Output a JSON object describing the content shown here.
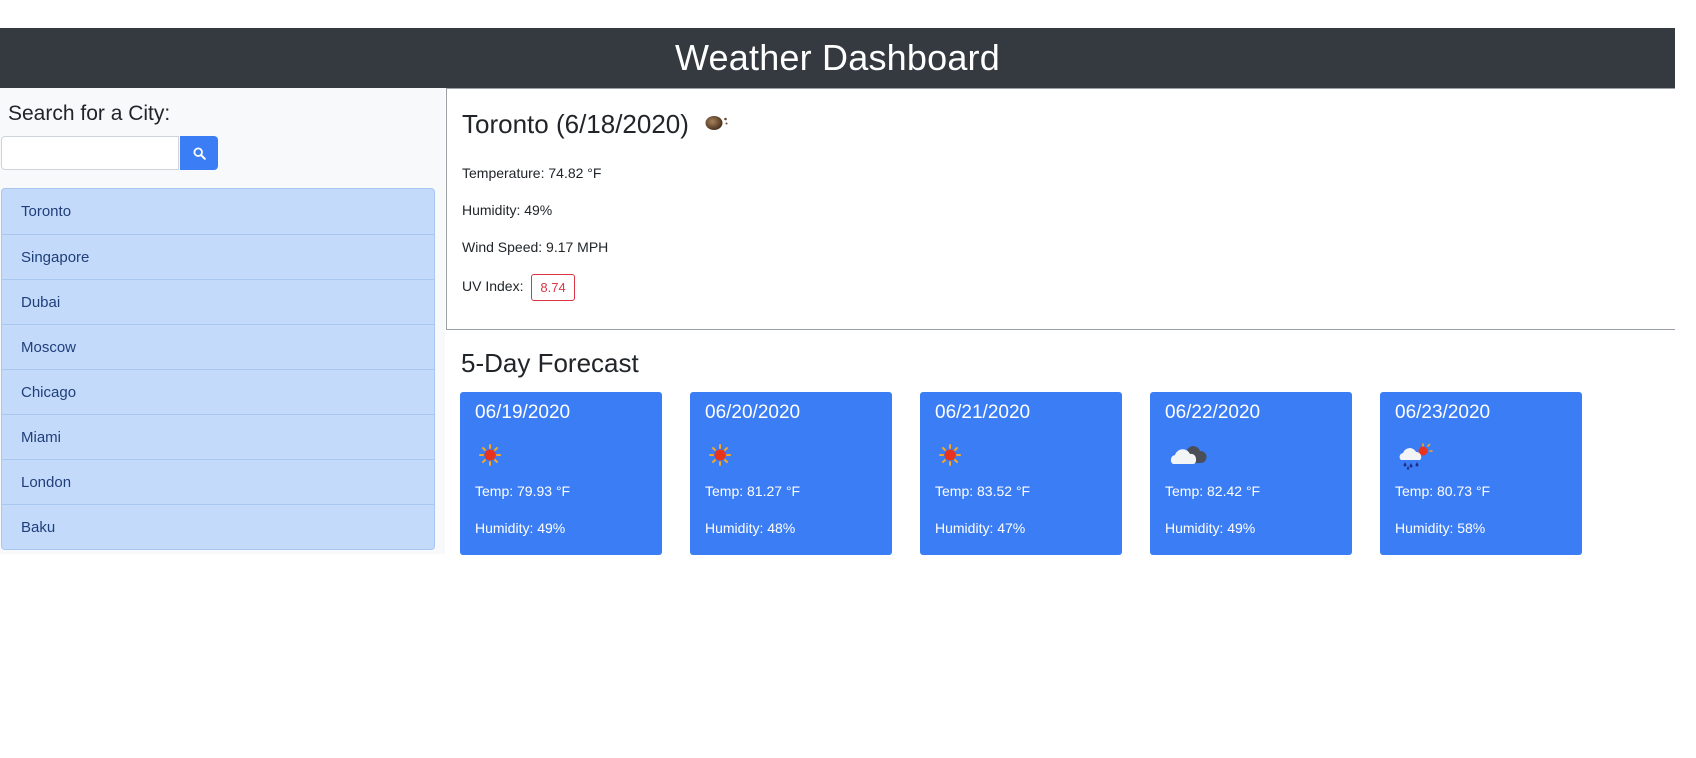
{
  "header": {
    "title": "Weather Dashboard"
  },
  "search": {
    "title": "Search for a City:",
    "value": "",
    "placeholder": "",
    "button_icon": "search-icon"
  },
  "cities": [
    "Toronto",
    "Singapore",
    "Dubai",
    "Moscow",
    "Chicago",
    "Miami",
    "London",
    "Baku"
  ],
  "current": {
    "title": "Toronto (6/18/2020)",
    "icon": "moon-clear-icon",
    "temperature": "Temperature: 74.82 °F",
    "humidity": "Humidity: 49%",
    "wind": "Wind Speed: 9.17 MPH",
    "uv_label": "UV Index:",
    "uv_value": "8.74"
  },
  "forecast": {
    "title": "5-Day Forecast",
    "days": [
      {
        "date": "06/19/2020",
        "icon": "sun-icon",
        "temp": "Temp: 79.93 °F",
        "humidity": "Humidity: 49%"
      },
      {
        "date": "06/20/2020",
        "icon": "sun-icon",
        "temp": "Temp: 81.27 °F",
        "humidity": "Humidity: 48%"
      },
      {
        "date": "06/21/2020",
        "icon": "sun-icon",
        "temp": "Temp: 83.52 °F",
        "humidity": "Humidity: 47%"
      },
      {
        "date": "06/22/2020",
        "icon": "cloudy-icon",
        "temp": "Temp: 82.42 °F",
        "humidity": "Humidity: 49%"
      },
      {
        "date": "06/23/2020",
        "icon": "sun-rain-icon",
        "temp": "Temp: 80.73 °F",
        "humidity": "Humidity: 58%"
      }
    ]
  },
  "colors": {
    "header_bg": "#343a40",
    "accent": "#3b7df5",
    "list_bg": "#c4dafb",
    "uv_danger": "#dc3545"
  }
}
